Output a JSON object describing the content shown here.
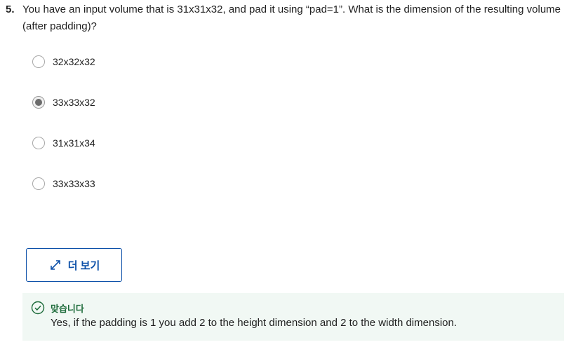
{
  "question": {
    "number": "5.",
    "text": "You have an input volume that is 31x31x32, and pad it using “pad=1”. What is the dimension of the resulting volume (after padding)?"
  },
  "options": [
    {
      "label": "32x32x32",
      "selected": false
    },
    {
      "label": "33x33x32",
      "selected": true
    },
    {
      "label": "31x31x34",
      "selected": false
    },
    {
      "label": "33x33x33",
      "selected": false
    }
  ],
  "more_button": {
    "label": "더 보기",
    "icon": "expand-arrows-icon"
  },
  "feedback": {
    "icon": "check-circle-icon",
    "title": "맞습니다",
    "text": "Yes, if the padding is 1 you add 2 to the height dimension and 2 to the width dimension."
  },
  "colors": {
    "accent": "#0b4fa8",
    "success": "#1d6b3a",
    "feedback_bg": "#f1f8f4"
  }
}
